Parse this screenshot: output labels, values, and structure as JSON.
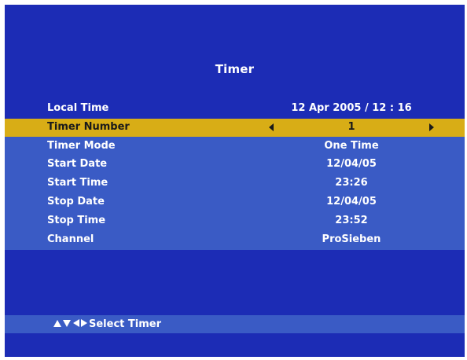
{
  "screen": {
    "title": "Timer"
  },
  "local_time": {
    "label": "Local Time",
    "value": "12 Apr 2005 / 12 : 16"
  },
  "settings": [
    {
      "label": "Timer Number",
      "value": "1",
      "selected": true
    },
    {
      "label": "Timer Mode",
      "value": "One Time",
      "selected": false
    },
    {
      "label": "Start Date",
      "value": "12/04/05",
      "selected": false
    },
    {
      "label": "Start Time",
      "value": "23:26",
      "selected": false
    },
    {
      "label": "Stop Date",
      "value": "12/04/05",
      "selected": false
    },
    {
      "label": "Stop Time",
      "value": "23:52",
      "selected": false
    },
    {
      "label": "Channel",
      "value": "ProSieben",
      "selected": false
    }
  ],
  "help": {
    "icons": [
      "up-arrow-icon",
      "down-arrow-icon",
      "left-arrow-icon",
      "right-arrow-icon"
    ],
    "text": "Select Timer"
  },
  "colors": {
    "background": "#1c2cb5",
    "panel": "#3a5bc5",
    "highlight": "#d8ad16",
    "text": "#ffffff"
  }
}
